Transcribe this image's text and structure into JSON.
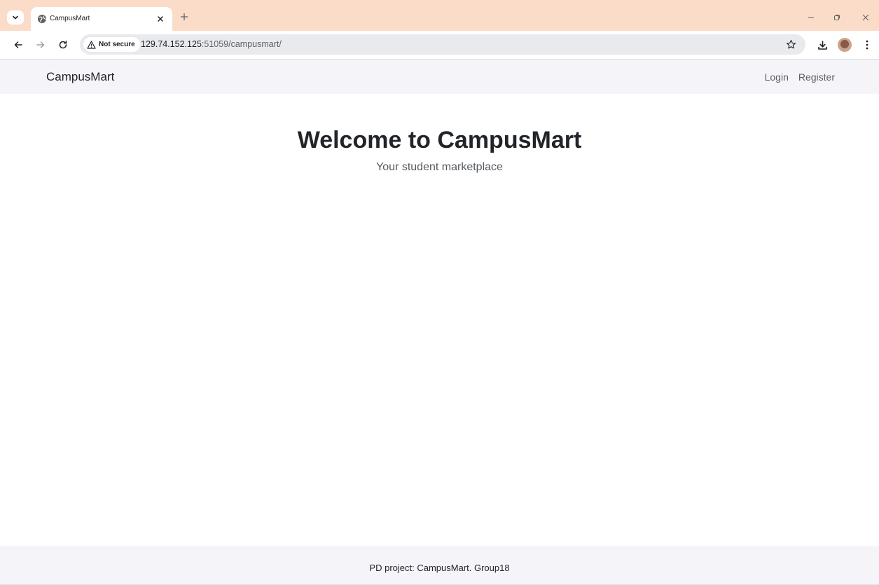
{
  "browser": {
    "tab": {
      "title": "CampusMart"
    },
    "omnibox": {
      "security_label": "Not secure",
      "url_host": "129.74.152.125",
      "url_rest": ":51059/campusmart/"
    }
  },
  "page": {
    "navbar": {
      "brand": "CampusMart",
      "links": {
        "login": "Login",
        "register": "Register"
      }
    },
    "hero": {
      "title": "Welcome to CampusMart",
      "subtitle": "Your student marketplace"
    },
    "footer": {
      "text": "PD project: CampusMart. Group18"
    }
  },
  "colors": {
    "tabstrip_bg": "#fbdcc9",
    "navbar_bg": "#f5f5f9",
    "text_primary": "#212529",
    "text_muted": "#5b5f64"
  },
  "icons": {
    "tab_search": "chevron-down-icon",
    "favicon": "globe-icon",
    "tab_close": "close-icon",
    "new_tab": "plus-icon",
    "minimize": "minimize-icon",
    "restore": "restore-icon",
    "close_window": "close-icon",
    "back": "arrow-left-icon",
    "forward": "arrow-right-icon",
    "reload": "reload-icon",
    "warning": "warning-icon",
    "bookmark": "star-icon",
    "downloads": "download-icon",
    "menu": "kebab-menu-icon"
  }
}
